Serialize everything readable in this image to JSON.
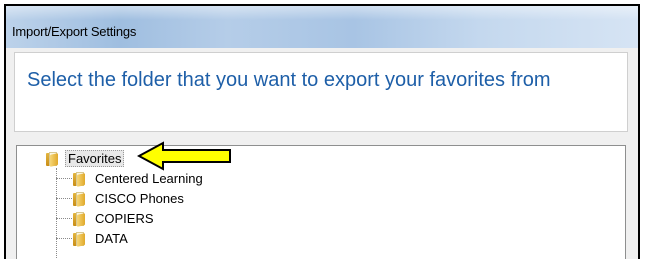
{
  "window": {
    "title": "Import/Export Settings"
  },
  "header": {
    "instruction": "Select the folder that you want to export your favorites from"
  },
  "tree": {
    "root": {
      "label": "Favorites",
      "icon": "folder-icon"
    },
    "children": [
      {
        "label": "Centered Learning",
        "icon": "folder-icon"
      },
      {
        "label": "CISCO Phones",
        "icon": "folder-icon"
      },
      {
        "label": "COPIERS",
        "icon": "folder-icon"
      },
      {
        "label": "DATA",
        "icon": "folder-icon"
      }
    ]
  },
  "annotation": {
    "icon": "yellow-arrow-icon",
    "color": "#ffff00"
  }
}
